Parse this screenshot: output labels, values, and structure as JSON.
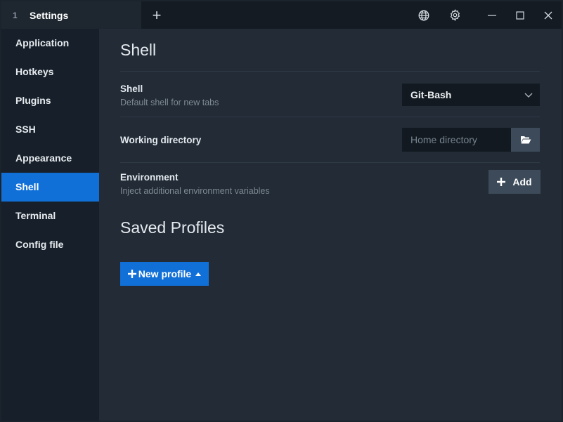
{
  "titlebar": {
    "tab_index": "1",
    "tab_title": "Settings",
    "new_tab_glyph": "+"
  },
  "sidebar": {
    "items": [
      {
        "label": "Application"
      },
      {
        "label": "Hotkeys"
      },
      {
        "label": "Plugins"
      },
      {
        "label": "SSH"
      },
      {
        "label": "Appearance"
      },
      {
        "label": "Shell",
        "active": true
      },
      {
        "label": "Terminal"
      },
      {
        "label": "Config file"
      }
    ]
  },
  "main": {
    "title": "Shell",
    "shell_row": {
      "label": "Shell",
      "description": "Default shell for new tabs",
      "selected": "Git-Bash"
    },
    "workdir_row": {
      "label": "Working directory",
      "placeholder": "Home directory",
      "value": ""
    },
    "env_row": {
      "label": "Environment",
      "description": "Inject additional environment variables",
      "add_label": "Add"
    },
    "profiles_title": "Saved Profiles",
    "new_profile_label": "New profile"
  },
  "colors": {
    "accent": "#1170d8",
    "sidebar_bg": "#17202a",
    "main_bg": "#222b36",
    "titlebar_bg": "#141b22",
    "secondary_button": "#3c4a59"
  },
  "icons": [
    "plus-icon",
    "globe-icon",
    "gear-icon",
    "minimize-icon",
    "maximize-icon",
    "close-icon",
    "chevron-down-icon",
    "folder-open-icon",
    "caret-up-icon"
  ]
}
